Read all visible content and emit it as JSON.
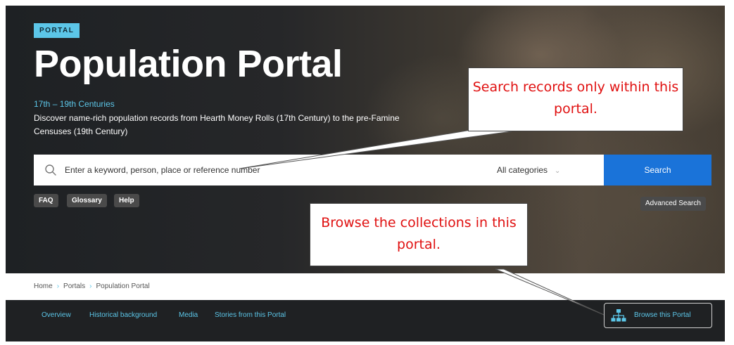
{
  "hero": {
    "badge": "PORTAL",
    "title": "Population Portal",
    "subtitle": "17th – 19th Centuries",
    "description": "Discover name-rich population records from Hearth Money Rolls (17th Century) to the pre-Famine Censuses (19th Century)"
  },
  "search": {
    "placeholder": "Enter a keyword, person, place or reference number",
    "category": "All categories",
    "button": "Search"
  },
  "chips": [
    "FAQ",
    "Glossary",
    "Help"
  ],
  "advanced_search": "Advanced Search",
  "breadcrumb": [
    "Home",
    "Portals",
    "Population Portal"
  ],
  "nav": [
    "Overview",
    "Historical background",
    "Media",
    "Stories from this Portal"
  ],
  "browse_button": "Browse this Portal",
  "callouts": {
    "search": "Search records only within this portal.",
    "browse": "Browse the collections in this portal."
  },
  "colors": {
    "accent": "#5cc6e8",
    "search_button": "#1a73d9",
    "callout_text": "#e01010"
  },
  "icons": {
    "search": "magnifier-icon",
    "category": "chevron-down-icon",
    "browse": "sitemap-icon"
  }
}
